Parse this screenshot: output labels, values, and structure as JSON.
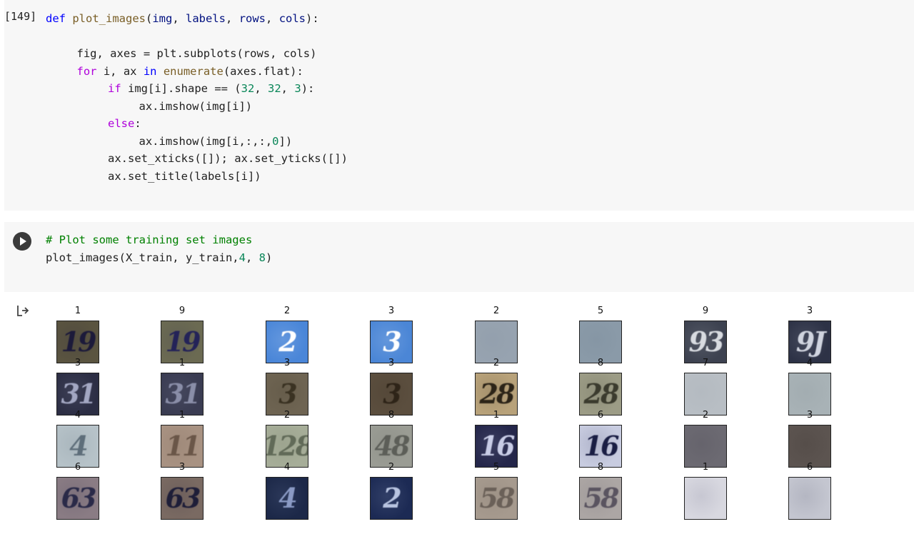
{
  "cell1": {
    "exec_count": "[149]",
    "lines": [
      {
        "indent": 0,
        "tokens": [
          [
            "kw",
            "def"
          ],
          [
            "txt",
            " "
          ],
          [
            "fn",
            "plot_images"
          ],
          [
            "txt",
            "("
          ],
          [
            "par",
            "img"
          ],
          [
            "txt",
            ", "
          ],
          [
            "par",
            "labels"
          ],
          [
            "txt",
            ", "
          ],
          [
            "par",
            "rows"
          ],
          [
            "txt",
            ", "
          ],
          [
            "par",
            "cols"
          ],
          [
            "txt",
            "):"
          ]
        ]
      },
      {
        "indent": 0,
        "tokens": []
      },
      {
        "indent": 1,
        "tokens": [
          [
            "txt",
            "fig, axes = plt.subplots(rows, cols)"
          ]
        ]
      },
      {
        "indent": 1,
        "tokens": [
          [
            "kw2",
            "for"
          ],
          [
            "txt",
            " i, ax "
          ],
          [
            "kw",
            "in"
          ],
          [
            "txt",
            " "
          ],
          [
            "fn",
            "enumerate"
          ],
          [
            "txt",
            "(axes.flat):"
          ]
        ]
      },
      {
        "indent": 2,
        "tokens": [
          [
            "kw2",
            "if"
          ],
          [
            "txt",
            " img[i].shape == ("
          ],
          [
            "num",
            "32"
          ],
          [
            "txt",
            ", "
          ],
          [
            "num",
            "32"
          ],
          [
            "txt",
            ", "
          ],
          [
            "num",
            "3"
          ],
          [
            "txt",
            "):"
          ]
        ]
      },
      {
        "indent": 3,
        "tokens": [
          [
            "txt",
            "ax.imshow(img[i])"
          ]
        ]
      },
      {
        "indent": 2,
        "tokens": [
          [
            "kw2",
            "else"
          ],
          [
            "txt",
            ":"
          ]
        ]
      },
      {
        "indent": 3,
        "tokens": [
          [
            "txt",
            "ax.imshow(img[i,:,:,"
          ],
          [
            "num",
            "0"
          ],
          [
            "txt",
            "])"
          ]
        ]
      },
      {
        "indent": 2,
        "tokens": [
          [
            "txt",
            "ax.set_xticks([]); ax.set_yticks([])"
          ]
        ]
      },
      {
        "indent": 2,
        "tokens": [
          [
            "txt",
            "ax.set_title(labels[i])"
          ]
        ]
      }
    ]
  },
  "cell2": {
    "lines": [
      {
        "indent": 0,
        "tokens": [
          [
            "cm",
            "# Plot some training set images"
          ]
        ]
      },
      {
        "indent": 0,
        "tokens": [
          [
            "txt",
            "plot_images(X_train, y_train,"
          ],
          [
            "num",
            "4"
          ],
          [
            "txt",
            ", "
          ],
          [
            "num",
            "8"
          ],
          [
            "txt",
            ")"
          ]
        ]
      }
    ]
  },
  "output": {
    "icon": "output-arrow-icon",
    "grid": [
      [
        {
          "label": "1",
          "glyph": "19",
          "bg": "#5a5440",
          "fg": "#1c1a3a"
        },
        {
          "label": "9",
          "glyph": "19",
          "bg": "#6b6a52",
          "fg": "#242358"
        },
        {
          "label": "2",
          "glyph": "2",
          "bg": "#4a86d8",
          "fg": "#ffffff"
        },
        {
          "label": "3",
          "glyph": "3",
          "bg": "#4b86d6",
          "fg": "#ffffff"
        },
        {
          "label": "2",
          "glyph": "",
          "bg": "#97a3b0",
          "fg": "#7d8a99"
        },
        {
          "label": "5",
          "glyph": "",
          "bg": "#8a9aa8",
          "fg": "#6b7c8c"
        },
        {
          "label": "9",
          "glyph": "93",
          "bg": "#3d4250",
          "fg": "#d8dbe0"
        },
        {
          "label": "3",
          "glyph": "9J",
          "bg": "#2d3246",
          "fg": "#d0d4df"
        }
      ],
      [
        {
          "label": "3",
          "glyph": "31",
          "bg": "#2c2e44",
          "fg": "#a3a7c2"
        },
        {
          "label": "1",
          "glyph": "31",
          "bg": "#3a3c52",
          "fg": "#8a8ea8"
        },
        {
          "label": "3",
          "glyph": "3",
          "bg": "#6e6452",
          "fg": "#3a3222"
        },
        {
          "label": "3",
          "glyph": "3",
          "bg": "#5b4e3e",
          "fg": "#2e2418"
        },
        {
          "label": "2",
          "glyph": "28",
          "bg": "#b8a27a",
          "fg": "#2c2418"
        },
        {
          "label": "8",
          "glyph": "28",
          "bg": "#9c9c86",
          "fg": "#3b3b2e"
        },
        {
          "label": "7",
          "glyph": "",
          "bg": "#b8bec4",
          "fg": "#9aa2aa"
        },
        {
          "label": "4",
          "glyph": "",
          "bg": "#a8b2b6",
          "fg": "#7f8a90"
        }
      ],
      [
        {
          "label": "4",
          "glyph": "4",
          "bg": "#b6c2c8",
          "fg": "#5e6e7a"
        },
        {
          "label": "1",
          "glyph": "11",
          "bg": "#a89282",
          "fg": "#6a5648"
        },
        {
          "label": "2",
          "glyph": "128",
          "bg": "#a6ad98",
          "fg": "#616a58"
        },
        {
          "label": "8",
          "glyph": "48",
          "bg": "#9a9c94",
          "fg": "#5c5e58"
        },
        {
          "label": "1",
          "glyph": "16",
          "bg": "#24264a",
          "fg": "#c8cce6"
        },
        {
          "label": "6",
          "glyph": "16",
          "bg": "#c8cce0",
          "fg": "#1a1e44"
        },
        {
          "label": "2",
          "glyph": "",
          "bg": "#6c6a72",
          "fg": "#3e3a46"
        },
        {
          "label": "3",
          "glyph": "",
          "bg": "#5c5450",
          "fg": "#2e2622"
        }
      ],
      [
        {
          "label": "6",
          "glyph": "63",
          "bg": "#8a7c84",
          "fg": "#2a2a48"
        },
        {
          "label": "3",
          "glyph": "63",
          "bg": "#7a6a62",
          "fg": "#1e1e38"
        },
        {
          "label": "4",
          "glyph": "4",
          "bg": "#1c2848",
          "fg": "#8a9ac4"
        },
        {
          "label": "2",
          "glyph": "2",
          "bg": "#1c2a54",
          "fg": "#b8c4e0"
        },
        {
          "label": "5",
          "glyph": "58",
          "bg": "#a69a8e",
          "fg": "#6a6058"
        },
        {
          "label": "8",
          "glyph": "58",
          "bg": "#aca6a4",
          "fg": "#5a5460"
        },
        {
          "label": "1",
          "glyph": "",
          "bg": "#d8d8e0",
          "fg": "#5a5a78"
        },
        {
          "label": "6",
          "glyph": "",
          "bg": "#c4c6d0",
          "fg": "#4e5068"
        }
      ]
    ]
  }
}
